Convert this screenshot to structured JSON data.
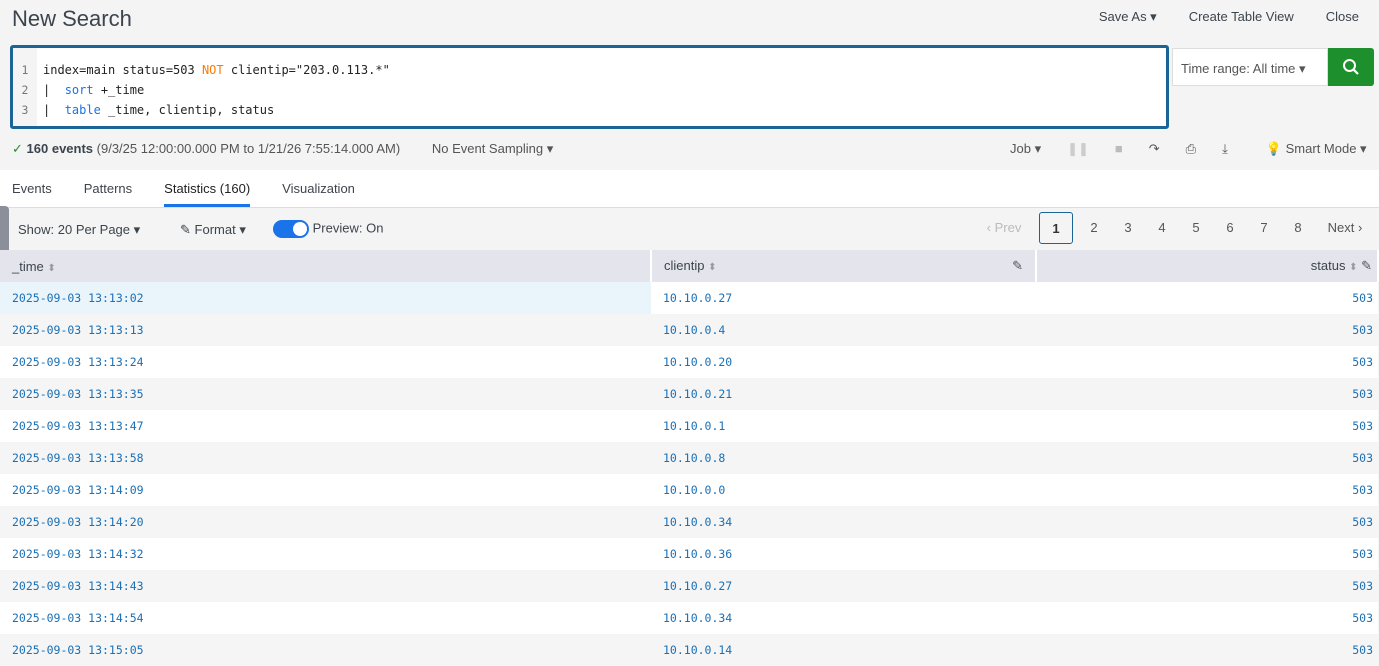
{
  "header": {
    "title": "New Search",
    "save_as": "Save As ▾",
    "create_table_view": "Create Table View",
    "close": "Close"
  },
  "query": {
    "line_numbers": [
      "1",
      "2",
      "3"
    ],
    "line1": {
      "a": "index=main status=503 ",
      "not": "NOT",
      "b": " clientip=\"203.0.113.*\""
    },
    "line2": {
      "pipe": "|  ",
      "cmd": "sort",
      "rest": " +_time"
    },
    "line3": {
      "pipe": "|  ",
      "cmd": "table",
      "rest": " _time, clientip, status"
    }
  },
  "time_range": "Time range: All time ▾",
  "status": {
    "check": "✓",
    "count": "160 events",
    "range": "(9/3/25 12:00:00.000 PM to 1/21/26 7:55:14.000 AM)",
    "sampling": "No Event Sampling ▾"
  },
  "jobbar": {
    "job": "Job ▾",
    "mode": "Smart Mode ▾"
  },
  "tabs": [
    "Events",
    "Patterns",
    "Statistics (160)",
    "Visualization"
  ],
  "toolbar": {
    "show": "Show: 20 Per Page ▾",
    "format": "Format ▾",
    "preview": "Preview: On"
  },
  "pager": {
    "prev": "‹ Prev",
    "pages": [
      "1",
      "2",
      "3",
      "4",
      "5",
      "6",
      "7",
      "8"
    ],
    "next": "Next ›"
  },
  "table": {
    "columns": [
      "_time",
      "clientip",
      "status"
    ],
    "rows": [
      [
        "2025-09-03 13:13:02",
        "10.10.0.27",
        "503"
      ],
      [
        "2025-09-03 13:13:13",
        "10.10.0.4",
        "503"
      ],
      [
        "2025-09-03 13:13:24",
        "10.10.0.20",
        "503"
      ],
      [
        "2025-09-03 13:13:35",
        "10.10.0.21",
        "503"
      ],
      [
        "2025-09-03 13:13:47",
        "10.10.0.1",
        "503"
      ],
      [
        "2025-09-03 13:13:58",
        "10.10.0.8",
        "503"
      ],
      [
        "2025-09-03 13:14:09",
        "10.10.0.0",
        "503"
      ],
      [
        "2025-09-03 13:14:20",
        "10.10.0.34",
        "503"
      ],
      [
        "2025-09-03 13:14:32",
        "10.10.0.36",
        "503"
      ],
      [
        "2025-09-03 13:14:43",
        "10.10.0.27",
        "503"
      ],
      [
        "2025-09-03 13:14:54",
        "10.10.0.34",
        "503"
      ],
      [
        "2025-09-03 13:15:05",
        "10.10.0.14",
        "503"
      ]
    ]
  }
}
